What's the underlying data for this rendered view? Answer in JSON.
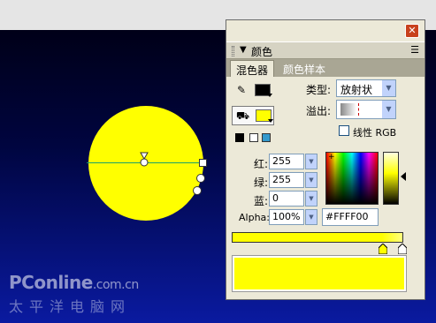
{
  "panel": {
    "title": "颜色",
    "tabs": [
      "混色器",
      "颜色样本"
    ],
    "type_label": "类型:",
    "type_value": "放射状",
    "overflow_label": "溢出:",
    "linear_rgb_label": "线性 RGB",
    "red_label": "红:",
    "green_label": "绿:",
    "blue_label": "蓝:",
    "alpha_label": "Alpha:",
    "red_value": "255",
    "green_value": "255",
    "blue_value": "0",
    "alpha_value": "100%",
    "hex_value": "#FFFF00"
  },
  "watermark": {
    "line1": "PConline",
    "line1_suffix": ".com.cn",
    "line2": "太平洋电脑网"
  },
  "colors": {
    "stroke_color": "#000000",
    "fill_color": "#FFFF00",
    "gradient_color": "#FFFF00"
  },
  "icons": {
    "stroke": "pencil-icon",
    "fill": "paint-bucket-icon",
    "close": "close-icon",
    "menu": "options-menu-icon"
  }
}
